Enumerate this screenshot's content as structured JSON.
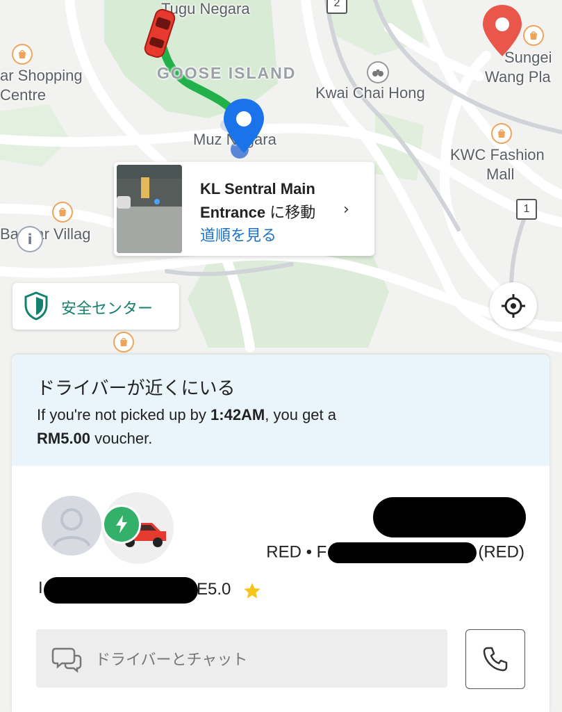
{
  "map": {
    "labels": {
      "tugu_negara": "Tugu Negara",
      "goose_island": "GOOSE ISLAND",
      "shopping_centre_1": "ar Shopping",
      "shopping_centre_2": "Centre",
      "kwai_chai_hong": "Kwai Chai Hong",
      "sungei_1": "Sungei",
      "sungei_2": "Wang Pla",
      "muzium": "Muz    Negara",
      "kwc_1": "KWC Fashion",
      "kwc_2": "Mall",
      "bangsar": "Ba  g  ar Villag",
      "road_2": "2",
      "road_1": "1"
    },
    "colors": {
      "route": "#22b04b",
      "pickup_pin": "#1a73e8",
      "destination_pin": "#e8574a",
      "car": "#e63a2e"
    }
  },
  "place_card": {
    "title": "KL Sentral Main",
    "title_line2": "Entrance",
    "move_suffix": "に移動",
    "chevron": "›",
    "link": "道順を見る"
  },
  "safety_center": {
    "label": "安全センター",
    "icon": "shield-icon"
  },
  "locate_button": {
    "icon": "locate-crosshair-icon"
  },
  "sheet": {
    "banner_title": "ドライバーが近くにいる",
    "banner_text_1": "If you're not picked up by ",
    "banner_time": "1:42AM",
    "banner_text_2": ", you get a",
    "banner_amount": "RM5.00",
    "banner_text_3": " voucher.",
    "vehicle_prefix": "RED • F",
    "vehicle_suffix": "(RED)",
    "rating_prefix": "I",
    "rating_suffix": "E",
    "rating": "5.0",
    "chat_placeholder": "ドライバーとチャット",
    "colors": {
      "banner_bg": "#e9f4fb",
      "accent_green": "#16806f",
      "bolt_green": "#33b06a",
      "star": "#f5c518"
    }
  }
}
